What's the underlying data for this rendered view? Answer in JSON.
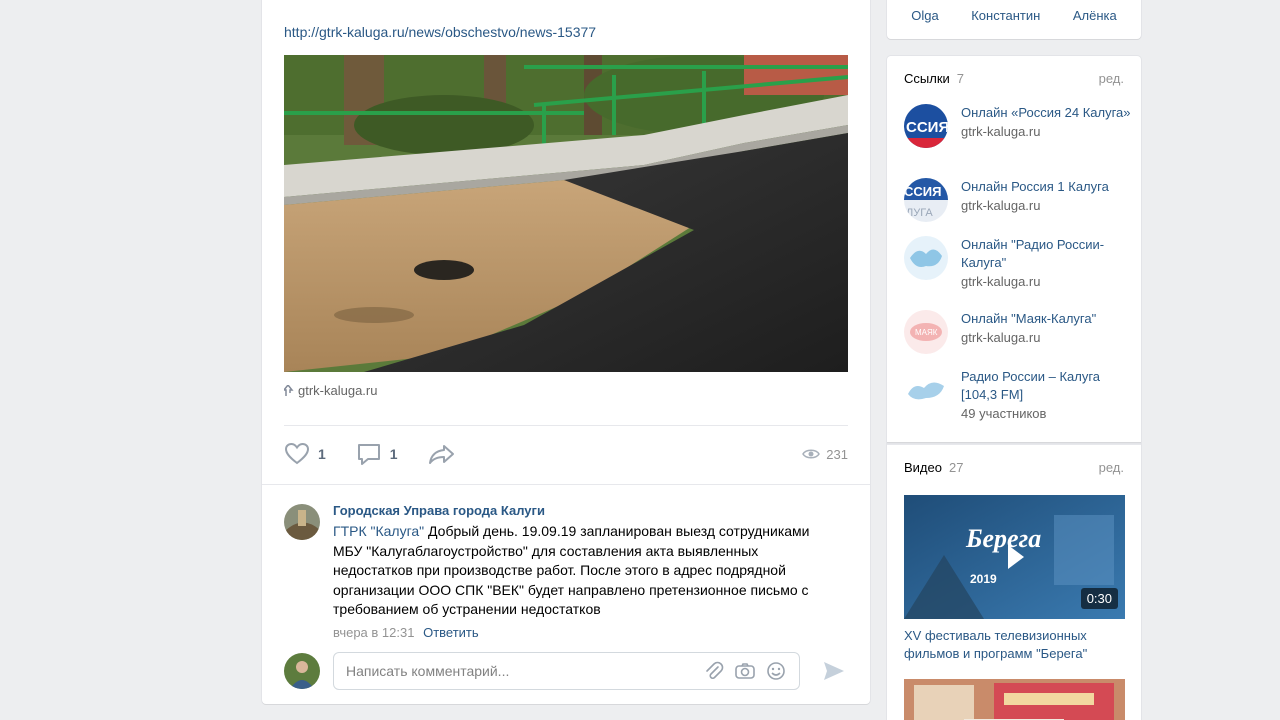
{
  "post": {
    "link_url": "http://gtrk-kaluga.ru/news/obschestvo/news-15377",
    "source": "gtrk-kaluga.ru",
    "likes": "1",
    "comments": "1",
    "views": "231"
  },
  "comment": {
    "author": "Городская Управа города Калуги",
    "mention": "ГТРК \"Калуга\"",
    "text": " Добрый день. 19.09.19 запланирован выезд сотрудниками МБУ \"Калугаблагоустройство\" для составления акта выявленных недостатков при производстве работ. После этого в адрес подрядной организации ООО СПК \"ВЕК\" будет направлено претензионное письмо с требованием об устранении недостатков",
    "time": "вчера в 12:31",
    "reply": "Ответить"
  },
  "reply_box": {
    "placeholder": "Написать комментарий..."
  },
  "friends": [
    "Olga",
    "Константин",
    "Алёнка"
  ],
  "links_block": {
    "title": "Ссылки",
    "count": "7",
    "edit": "ред.",
    "items": [
      {
        "title": "Онлайн «Россия 24 Калуга»",
        "sub": "gtrk-kaluga.ru"
      },
      {
        "title": "Онлайн Россия 1 Калуга",
        "sub": "gtrk-kaluga.ru"
      },
      {
        "title": "Онлайн \"Радио России-Калуга\"",
        "sub": "gtrk-kaluga.ru"
      },
      {
        "title": "Онлайн \"Маяк-Калуга\"",
        "sub": "gtrk-kaluga.ru"
      },
      {
        "title": "Радио России – Калуга [104,3 FM]",
        "sub": "49 участников"
      }
    ]
  },
  "video_block": {
    "title": "Видео",
    "count": "27",
    "edit": "ред.",
    "video_title": "XV фестиваль телевизионных фильмов и программ \"Берега\"",
    "duration": "0:30",
    "thumb_text": "Берега",
    "thumb_year": "2019"
  },
  "colors": {
    "link": "#2a5885",
    "background": "#edeef0",
    "muted": "#939393"
  }
}
